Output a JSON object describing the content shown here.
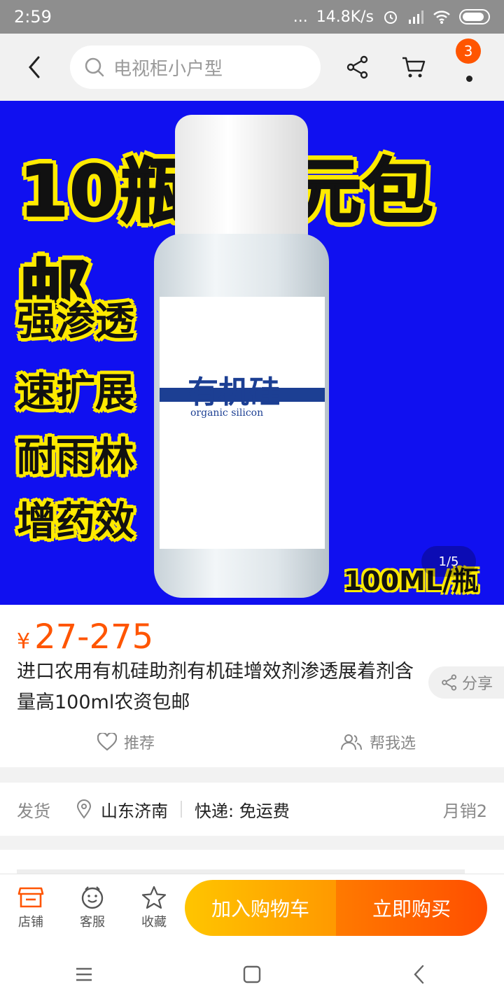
{
  "status_bar": {
    "time": "2:59",
    "network_speed": "14.8K/s",
    "dots": "..."
  },
  "header": {
    "search_placeholder": "电视柜小户型",
    "message_badge": "3"
  },
  "hero": {
    "promo_title": "10瓶27元包邮",
    "features": [
      "强渗透",
      "速扩展",
      "耐雨林",
      "增药效"
    ],
    "bottle_name": "有机硅",
    "bottle_subtitle": "organic silicon",
    "volume": "100ML/瓶",
    "pager": "1/5"
  },
  "product": {
    "currency": "¥",
    "price": "27-275",
    "title": "进口农用有机硅助剂有机硅增效剂渗透展着剂含量高100ml农资包邮",
    "share_label": "分享",
    "recommend_label": "推荐",
    "help_choose_label": "帮我选"
  },
  "shipping": {
    "label": "发货",
    "location": "山东济南",
    "express": "快递: 免运费",
    "monthly_sales": "月销2"
  },
  "action_bar": {
    "shop_label": "店铺",
    "service_label": "客服",
    "favorite_label": "收藏",
    "add_to_cart": "加入购物车",
    "buy_now": "立即购买"
  },
  "colors": {
    "accent": "#ff5500",
    "cart_button": "#ffb000",
    "buy_button": "#ff5a00",
    "hero_bg": "#1010f0",
    "highlight_yellow": "#ffea00"
  }
}
